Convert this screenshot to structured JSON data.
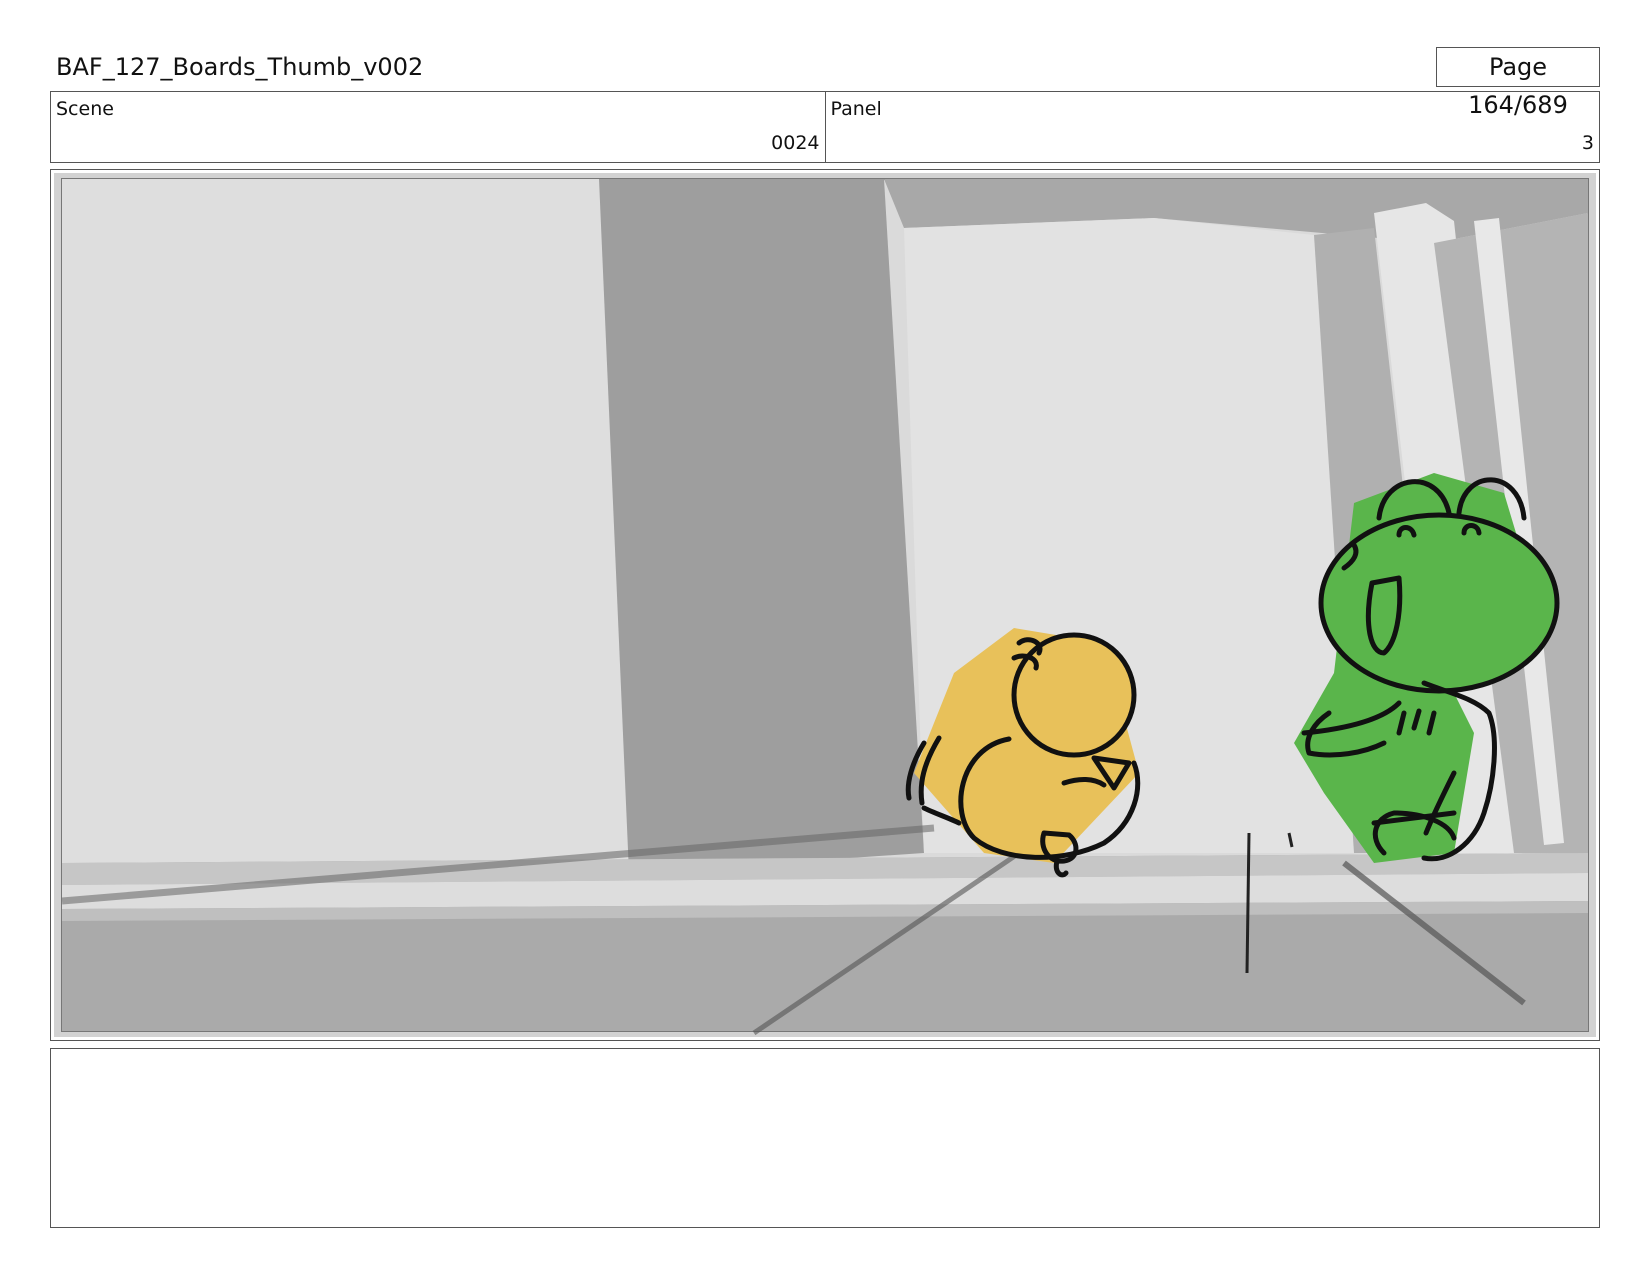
{
  "header": {
    "title": "BAF_127_Boards_Thumb_v002",
    "page_label": "Page 164/689"
  },
  "info": {
    "scene_label": "Scene",
    "scene_value": "0024",
    "panel_label": "Panel",
    "panel_value": "3"
  },
  "artwork": {
    "subject": "storyboard-sketch",
    "colors": {
      "yellow_character": "#E8C15A",
      "green_character": "#5AB54B",
      "line": "#111111",
      "wall_light": "#DEDEDE",
      "wall_dark": "#9E9E9E",
      "floor": "#AAAAAA"
    }
  },
  "notes": {
    "text": ""
  }
}
